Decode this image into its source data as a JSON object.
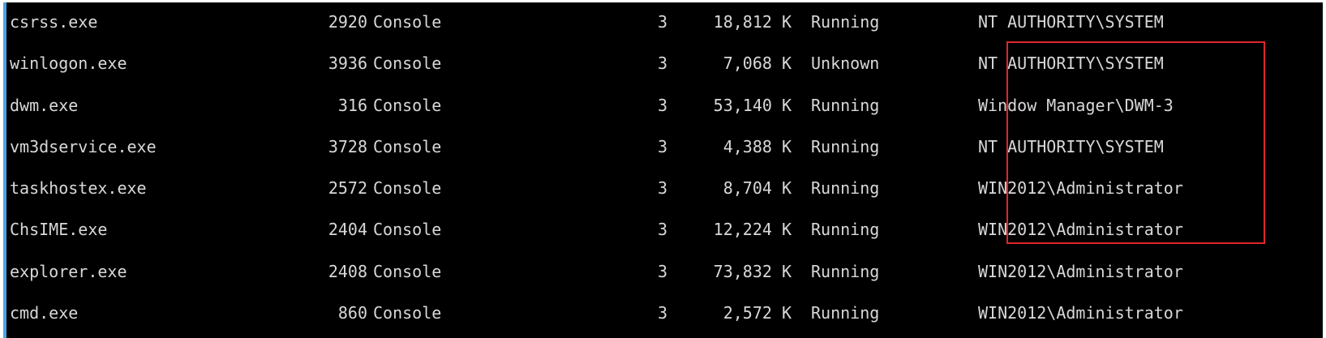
{
  "colors": {
    "background": "#000000",
    "text": "#d8d8d8",
    "highlight": "#e0262a",
    "left_accent": "#4aa3df"
  },
  "processes": [
    {
      "name": "csrss.exe",
      "pid": "2920",
      "session_name": "Console",
      "session_num": "3",
      "mem": "18,812 K",
      "status": "Running",
      "user": "NT AUTHORITY\\SYSTEM"
    },
    {
      "name": "winlogon.exe",
      "pid": "3936",
      "session_name": "Console",
      "session_num": "3",
      "mem": "7,068 K",
      "status": "Unknown",
      "user": "NT AUTHORITY\\SYSTEM"
    },
    {
      "name": "dwm.exe",
      "pid": "316",
      "session_name": "Console",
      "session_num": "3",
      "mem": "53,140 K",
      "status": "Running",
      "user": "Window Manager\\DWM-3"
    },
    {
      "name": "vm3dservice.exe",
      "pid": "3728",
      "session_name": "Console",
      "session_num": "3",
      "mem": "4,388 K",
      "status": "Running",
      "user": "NT AUTHORITY\\SYSTEM"
    },
    {
      "name": "taskhostex.exe",
      "pid": "2572",
      "session_name": "Console",
      "session_num": "3",
      "mem": "8,704 K",
      "status": "Running",
      "user": "WIN2012\\Administrator"
    },
    {
      "name": "ChsIME.exe",
      "pid": "2404",
      "session_name": "Console",
      "session_num": "3",
      "mem": "12,224 K",
      "status": "Running",
      "user": "WIN2012\\Administrator"
    },
    {
      "name": "explorer.exe",
      "pid": "2408",
      "session_name": "Console",
      "session_num": "3",
      "mem": "73,832 K",
      "status": "Running",
      "user": "WIN2012\\Administrator"
    },
    {
      "name": "cmd.exe",
      "pid": "860",
      "session_name": "Console",
      "session_num": "3",
      "mem": "2,572 K",
      "status": "Running",
      "user": "WIN2012\\Administrator"
    }
  ]
}
